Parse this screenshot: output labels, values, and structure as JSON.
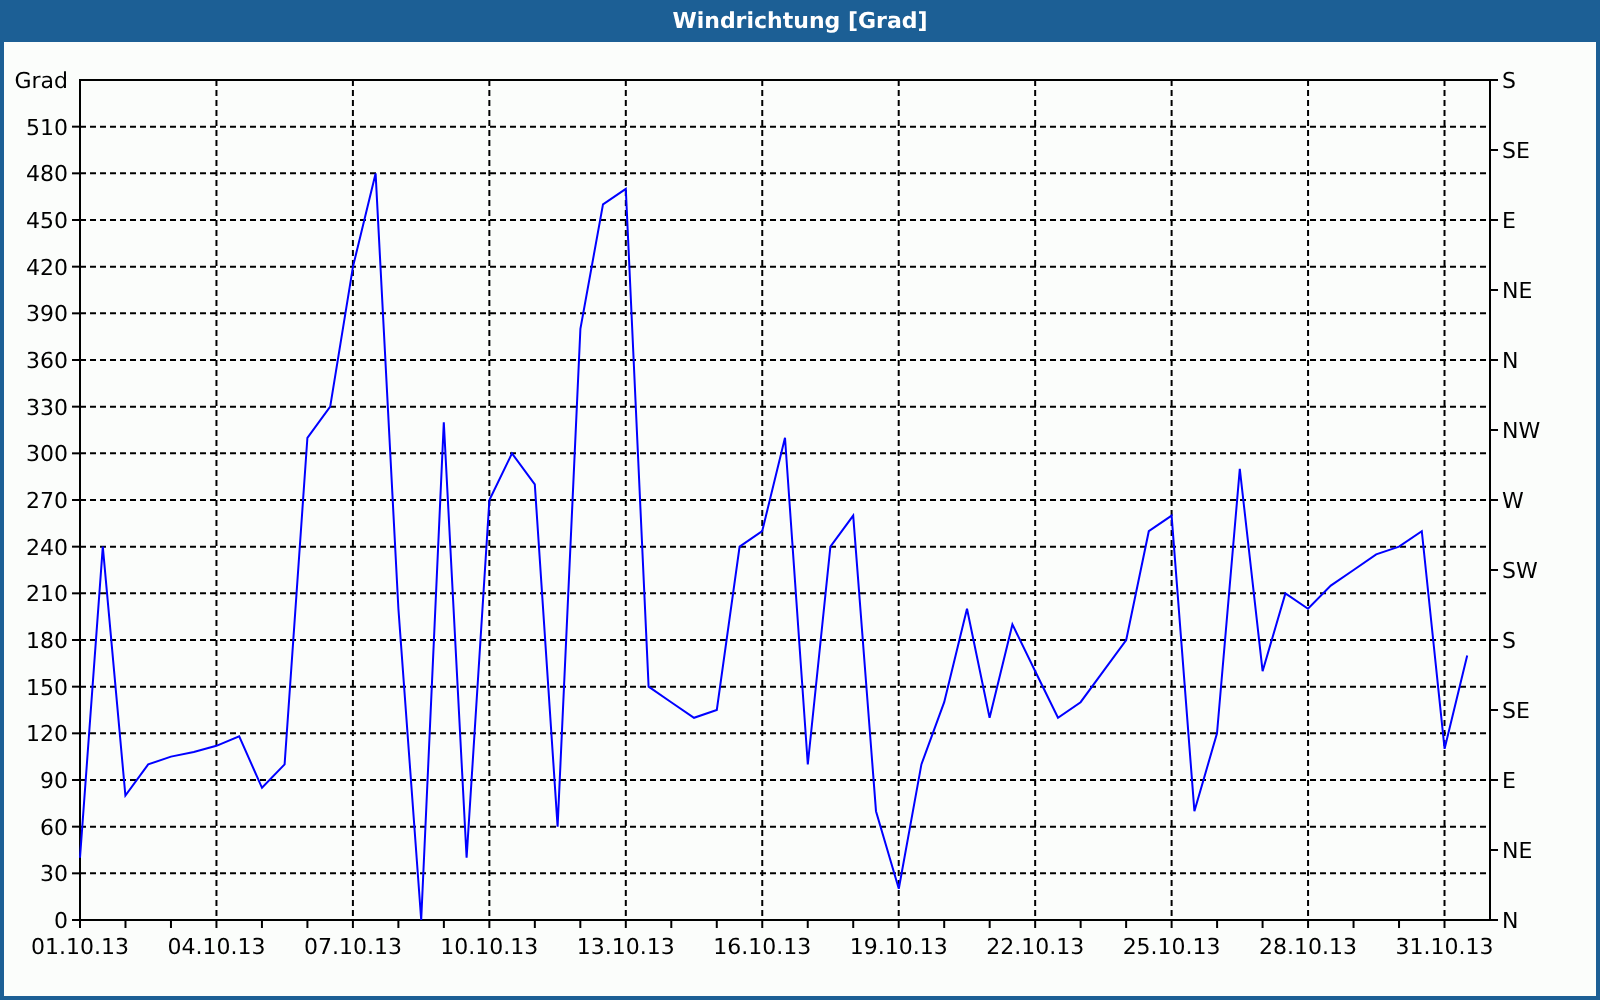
{
  "window": {
    "title": "Windrichtung [Grad]"
  },
  "chart": {
    "right_axis": {
      "labels": [
        "S",
        "SE",
        "E",
        "NE",
        "N",
        "NW",
        "W",
        "SW",
        "S",
        "SE",
        "E",
        "NE",
        "N"
      ]
    },
    "chart_data": {
      "type": "line",
      "grid": true,
      "ylabel": "Grad",
      "ylim": [
        0,
        540
      ],
      "categories": [
        "01.10.13",
        null,
        null,
        null,
        null,
        null,
        "04.10.13",
        null,
        null,
        null,
        null,
        null,
        "07.10.13",
        null,
        null,
        null,
        null,
        null,
        "10.10.13",
        null,
        null,
        null,
        null,
        null,
        "13.10.13",
        null,
        null,
        null,
        null,
        null,
        "16.10.13",
        null,
        null,
        null,
        null,
        null,
        "19.10.13",
        null,
        null,
        null,
        null,
        null,
        "22.10.13",
        null,
        null,
        null,
        null,
        null,
        "25.10.13",
        null,
        null,
        null,
        null,
        null,
        "28.10.13",
        null,
        null,
        null,
        null,
        null,
        "31.10.13",
        null
      ],
      "yticks": [
        0,
        30,
        60,
        90,
        120,
        150,
        180,
        210,
        240,
        270,
        300,
        330,
        360,
        390,
        420,
        450,
        480,
        510
      ],
      "series": [
        {
          "color": "#0000ff",
          "values": [
            40,
            240,
            80,
            100,
            105,
            108,
            112,
            118,
            85,
            100,
            310,
            330,
            420,
            480,
            200,
            0,
            320,
            40,
            270,
            300,
            280,
            60,
            380,
            460,
            470,
            150,
            140,
            130,
            135,
            240,
            250,
            310,
            100,
            240,
            260,
            70,
            20,
            100,
            140,
            200,
            130,
            190,
            160,
            130,
            140,
            160,
            180,
            250,
            260,
            70,
            120,
            290,
            160,
            210,
            200,
            215,
            225,
            235,
            240,
            250,
            110,
            170
          ]
        }
      ]
    }
  }
}
